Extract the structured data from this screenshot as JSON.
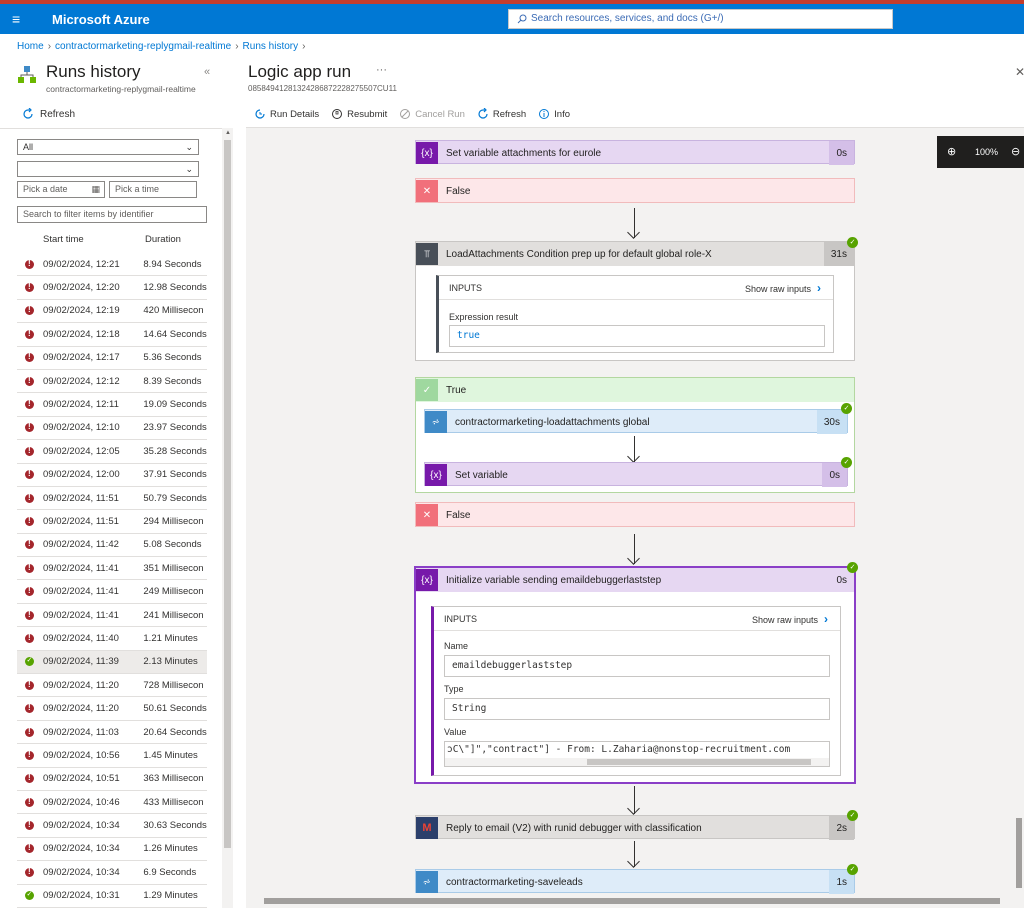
{
  "header": {
    "brand": "Microsoft Azure",
    "search_placeholder": "Search resources, services, and docs (G+/)"
  },
  "breadcrumb": [
    "Home",
    "contractormarketing-replygmail-realtime",
    "Runs history"
  ],
  "left": {
    "title": "Runs history",
    "subtitle": "contractormarketing-replygmail-realtime",
    "refresh": "Refresh",
    "status_filter": "All",
    "second_filter": "",
    "date_placeholder": "Pick a date",
    "time_placeholder": "Pick a time",
    "identifier_placeholder": "Search to filter items by identifier",
    "col_start": "Start time",
    "col_duration": "Duration",
    "runs": [
      {
        "status": "failed",
        "time": "09/02/2024, 12:21",
        "duration": "8.94 Seconds"
      },
      {
        "status": "failed",
        "time": "09/02/2024, 12:20",
        "duration": "12.98 Seconds"
      },
      {
        "status": "failed",
        "time": "09/02/2024, 12:19",
        "duration": "420 Millisecon"
      },
      {
        "status": "failed",
        "time": "09/02/2024, 12:18",
        "duration": "14.64 Seconds"
      },
      {
        "status": "failed",
        "time": "09/02/2024, 12:17",
        "duration": "5.36 Seconds"
      },
      {
        "status": "failed",
        "time": "09/02/2024, 12:12",
        "duration": "8.39 Seconds"
      },
      {
        "status": "failed",
        "time": "09/02/2024, 12:11",
        "duration": "19.09 Seconds"
      },
      {
        "status": "failed",
        "time": "09/02/2024, 12:10",
        "duration": "23.97 Seconds"
      },
      {
        "status": "failed",
        "time": "09/02/2024, 12:05",
        "duration": "35.28 Seconds"
      },
      {
        "status": "failed",
        "time": "09/02/2024, 12:00",
        "duration": "37.91 Seconds"
      },
      {
        "status": "failed",
        "time": "09/02/2024, 11:51",
        "duration": "50.79 Seconds"
      },
      {
        "status": "failed",
        "time": "09/02/2024, 11:51",
        "duration": "294 Millisecon"
      },
      {
        "status": "failed",
        "time": "09/02/2024, 11:42",
        "duration": "5.08 Seconds"
      },
      {
        "status": "failed",
        "time": "09/02/2024, 11:41",
        "duration": "351 Millisecon"
      },
      {
        "status": "failed",
        "time": "09/02/2024, 11:41",
        "duration": "249 Millisecon"
      },
      {
        "status": "failed",
        "time": "09/02/2024, 11:41",
        "duration": "241 Millisecon"
      },
      {
        "status": "failed",
        "time": "09/02/2024, 11:40",
        "duration": "1.21 Minutes"
      },
      {
        "status": "succeeded",
        "time": "09/02/2024, 11:39",
        "duration": "2.13 Minutes"
      },
      {
        "status": "failed",
        "time": "09/02/2024, 11:20",
        "duration": "728 Millisecon"
      },
      {
        "status": "failed",
        "time": "09/02/2024, 11:20",
        "duration": "50.61 Seconds"
      },
      {
        "status": "failed",
        "time": "09/02/2024, 11:03",
        "duration": "20.64 Seconds"
      },
      {
        "status": "failed",
        "time": "09/02/2024, 10:56",
        "duration": "1.45 Minutes"
      },
      {
        "status": "failed",
        "time": "09/02/2024, 10:51",
        "duration": "363 Millisecon"
      },
      {
        "status": "failed",
        "time": "09/02/2024, 10:46",
        "duration": "433 Millisecon"
      },
      {
        "status": "failed",
        "time": "09/02/2024, 10:34",
        "duration": "30.63 Seconds"
      },
      {
        "status": "failed",
        "time": "09/02/2024, 10:34",
        "duration": "1.26 Minutes"
      },
      {
        "status": "failed",
        "time": "09/02/2024, 10:34",
        "duration": "6.9 Seconds"
      },
      {
        "status": "succeeded",
        "time": "09/02/2024, 10:31",
        "duration": "1.29 Minutes"
      }
    ]
  },
  "main": {
    "title": "Logic app run",
    "ellipsis": "···",
    "run_id": "08584941281324286872228275507CU11",
    "toolbar": {
      "run_details": "Run Details",
      "resubmit": "Resubmit",
      "cancel_run": "Cancel Run",
      "refresh": "Refresh",
      "info": "Info"
    },
    "zoom": "100%",
    "steps": {
      "set_attach_eurole": {
        "title": "Set variable attachments for eurole",
        "duration": "0s"
      },
      "false1": {
        "title": "False"
      },
      "load_condition": {
        "title": "LoadAttachments Condition prep up for default global role-X",
        "duration": "31s"
      },
      "load_inputs": {
        "header": "INPUTS",
        "raw": "Show raw inputs",
        "label": "Expression result",
        "value": "true"
      },
      "true_branch": {
        "title": "True"
      },
      "load_global": {
        "title": "contractormarketing-loadattachments global",
        "duration": "30s"
      },
      "set_variable": {
        "title": "Set variable",
        "duration": "0s"
      },
      "false2": {
        "title": "False"
      },
      "init_variable": {
        "title": "Initialize variable sending emaildebuggerlaststep",
        "duration": "0s"
      },
      "init_inputs": {
        "header": "INPUTS",
        "raw": "Show raw inputs",
        "name_label": "Name",
        "name_value": "emaildebuggerlaststep",
        "type_label": "Type",
        "type_value": "String",
        "value_label": "Value",
        "value_value": "ͻC\\\"]\",\"contract\"] - From: L.Zaharia@nonstop-recruitment.com"
      },
      "reply_email": {
        "title": "Reply to email (V2) with runid debugger with classification",
        "duration": "2s"
      },
      "saveleads": {
        "title": "contractormarketing-saveleads",
        "duration": "1s"
      }
    }
  },
  "colors": {
    "azure_blue": "#0078d4",
    "variable_purple": "#7719aa",
    "condition_gray": "#484f58",
    "workflow_blue": "#3f8ac7",
    "false_red": "#e74856",
    "true_green": "#6bb700",
    "gmail_red": "#c5221f",
    "success_green": "#57a300",
    "failed_red": "#a4262c"
  }
}
